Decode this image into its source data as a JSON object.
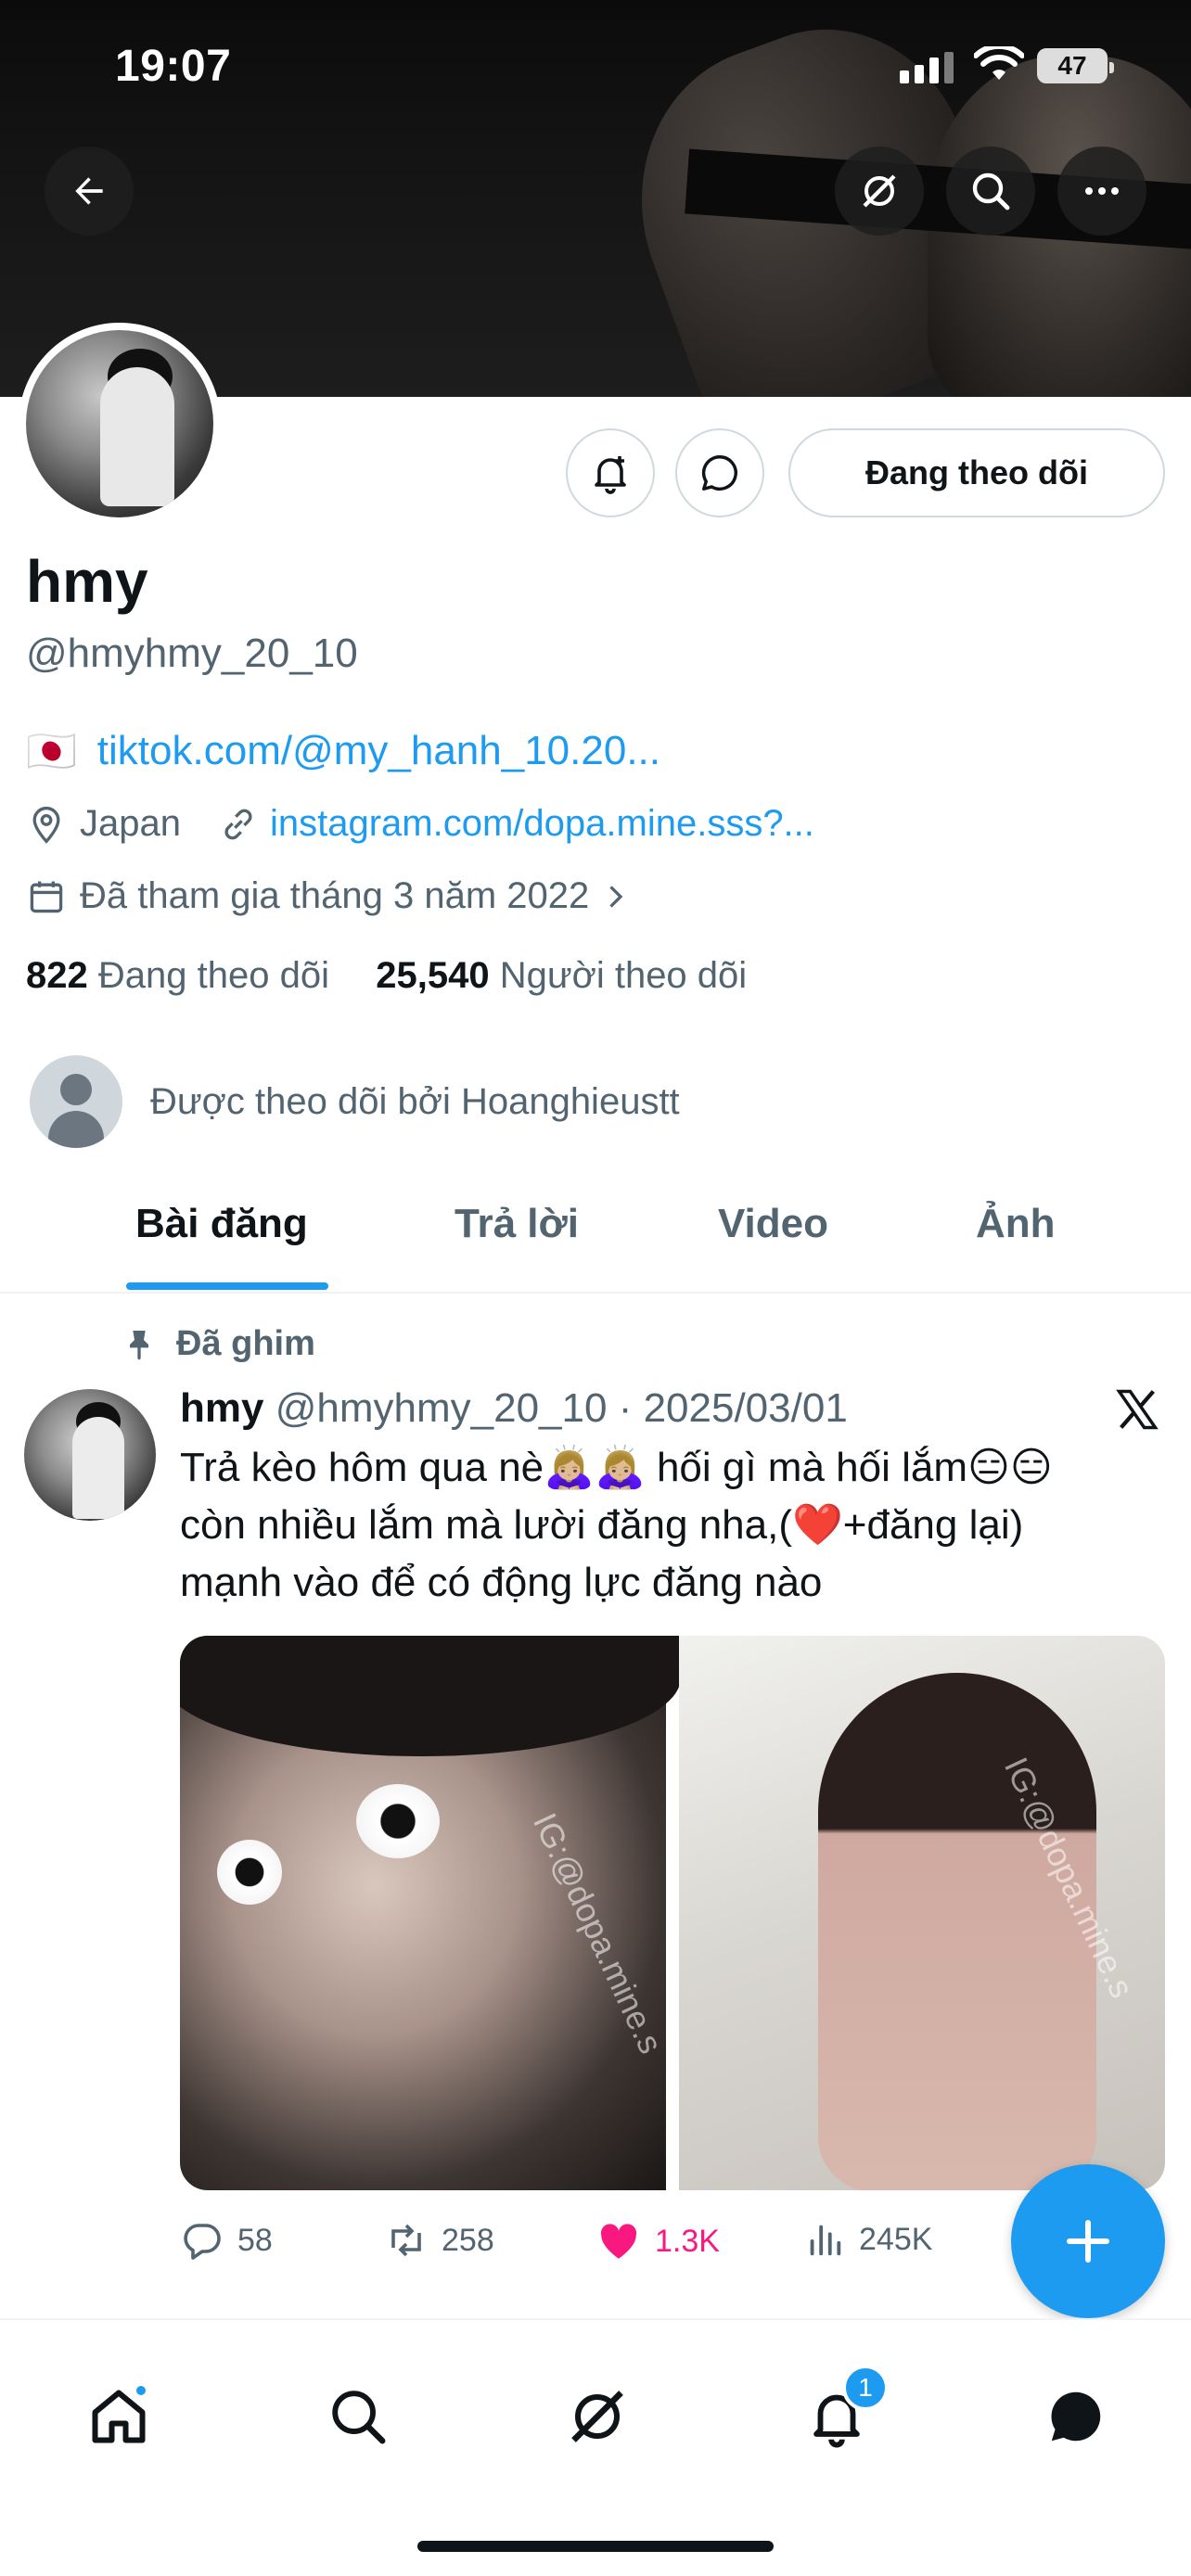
{
  "status_bar": {
    "time": "19:07",
    "battery": "47"
  },
  "profile": {
    "name": "hmy",
    "handle": "@hmyhmy_20_10",
    "flag": "🇯🇵",
    "bio_link": "tiktok.com/@my_hanh_10.20...",
    "location": "Japan",
    "website": "instagram.com/dopa.mine.sss?...",
    "joined": "Đã tham gia tháng 3 năm 2022",
    "following_count": "822",
    "following_label": "Đang theo dõi",
    "followers_count": "25,540",
    "followers_label": "Người theo dõi",
    "followed_by": "Được theo dõi bởi Hoanghieustt",
    "follow_button": "Đang theo dõi"
  },
  "tabs": [
    "Bài đăng",
    "Trả lời",
    "Video",
    "Ảnh"
  ],
  "pinned_label": "Đã ghim",
  "post": {
    "author": "hmy",
    "handle": "@hmyhmy_20_10",
    "separator": " · ",
    "date": "2025/03/01",
    "text": "Trả kèo hôm qua nè🙇🏼‍♀️🙇🏼‍♀️ hối gì mà hối lắm😑😑 còn nhiều lắm mà lười đăng nha,(❤️+đăng lại) mạnh vào để có động lực đăng nào",
    "image_watermarks": [
      "IG:@dopa.mine.s",
      "IG:@dopa.mine.s"
    ],
    "replies": "58",
    "reposts": "258",
    "likes": "1.3K",
    "views": "245K"
  },
  "bottom_nav": {
    "notifications_badge": "1"
  },
  "colors": {
    "accent": "#1d9bf0",
    "like": "#f91880",
    "muted": "#536471",
    "text": "#0f1419"
  },
  "icons": [
    "back-arrow-icon",
    "grok-icon",
    "search-icon",
    "more-icon",
    "add-notification-icon",
    "message-icon",
    "location-icon",
    "link-icon",
    "calendar-icon",
    "chevron-right-icon",
    "pin-icon",
    "x-logo-icon",
    "reply-icon",
    "repost-icon",
    "heart-icon",
    "views-icon",
    "compose-plus-icon",
    "home-icon",
    "nav-search-icon",
    "nav-grok-icon",
    "bell-icon",
    "chat-icon"
  ]
}
